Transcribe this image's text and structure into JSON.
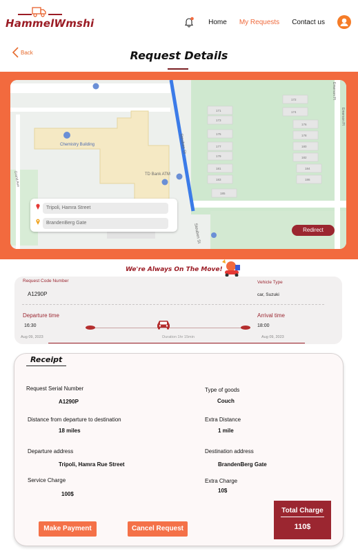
{
  "brand": {
    "name": "HammelWmshi"
  },
  "nav": {
    "items": [
      {
        "label": "Home",
        "active": false
      },
      {
        "label": "My Requests",
        "active": true
      },
      {
        "label": "Contact us",
        "active": false
      }
    ]
  },
  "page": {
    "back_label": "Back",
    "title": "Request Details"
  },
  "map": {
    "labels": {
      "chemistry": "Chemistry Building",
      "atm": "TD Bank ATM",
      "street_steuben": "Steuben St",
      "street_grand": "Grand Ave",
      "street_emerson_1": "Emerson Pl",
      "street_emerson_2": "Emerson Pl",
      "chem_small": "Chemistry Building"
    },
    "house_numbers": [
      "171",
      "173",
      "175",
      "177",
      "179",
      "181",
      "183",
      "185",
      "172",
      "174",
      "176",
      "178",
      "180",
      "182",
      "184",
      "186"
    ],
    "from": "Tripoli, Hamra Street",
    "to": "BrandenBerg Gate",
    "redirect_label": "Redirect"
  },
  "slogan": "We're Always On The Move!",
  "request": {
    "code_label": "Request Code Number",
    "code": "A1290P",
    "vehicle_label": "Vehicle Type",
    "vehicle": "car, Suzuki",
    "departure_label": "Departure time",
    "departure_time": "16:30",
    "departure_date": "Aug 09, 2023",
    "arrival_label": "Arrival time",
    "arrival_time": "18:00",
    "arrival_date": "Aug 09, 2023",
    "duration": "Duration 1hr 15min"
  },
  "receipt": {
    "title": "Receipt",
    "serial_label": "Request Serial Number",
    "serial": "A1290P",
    "goods_label": "Type of goods",
    "goods": "Couch",
    "distance_label": "Distance from departure to destination",
    "distance": "18 miles",
    "extra_distance_label": "Extra Distance",
    "extra_distance": "1 mile",
    "departure_addr_label": "Departure address",
    "departure_addr": "Tripoli, Hamra Rue Street",
    "destination_addr_label": "Destination address",
    "destination_addr": "BrandenBerg Gate",
    "service_label": "Service Charge",
    "service": "100$",
    "extra_charge_label": "Extra Charge",
    "extra_charge": "10$",
    "total_label": "Total Charge",
    "total": "110$"
  },
  "actions": {
    "pay": "Make Payment",
    "cancel": "Cancel Request"
  },
  "colors": {
    "brand_red": "#9b1c25",
    "accent_orange": "#f26a3e",
    "button_orange": "#f47148",
    "route_blue": "#3b7be8"
  }
}
